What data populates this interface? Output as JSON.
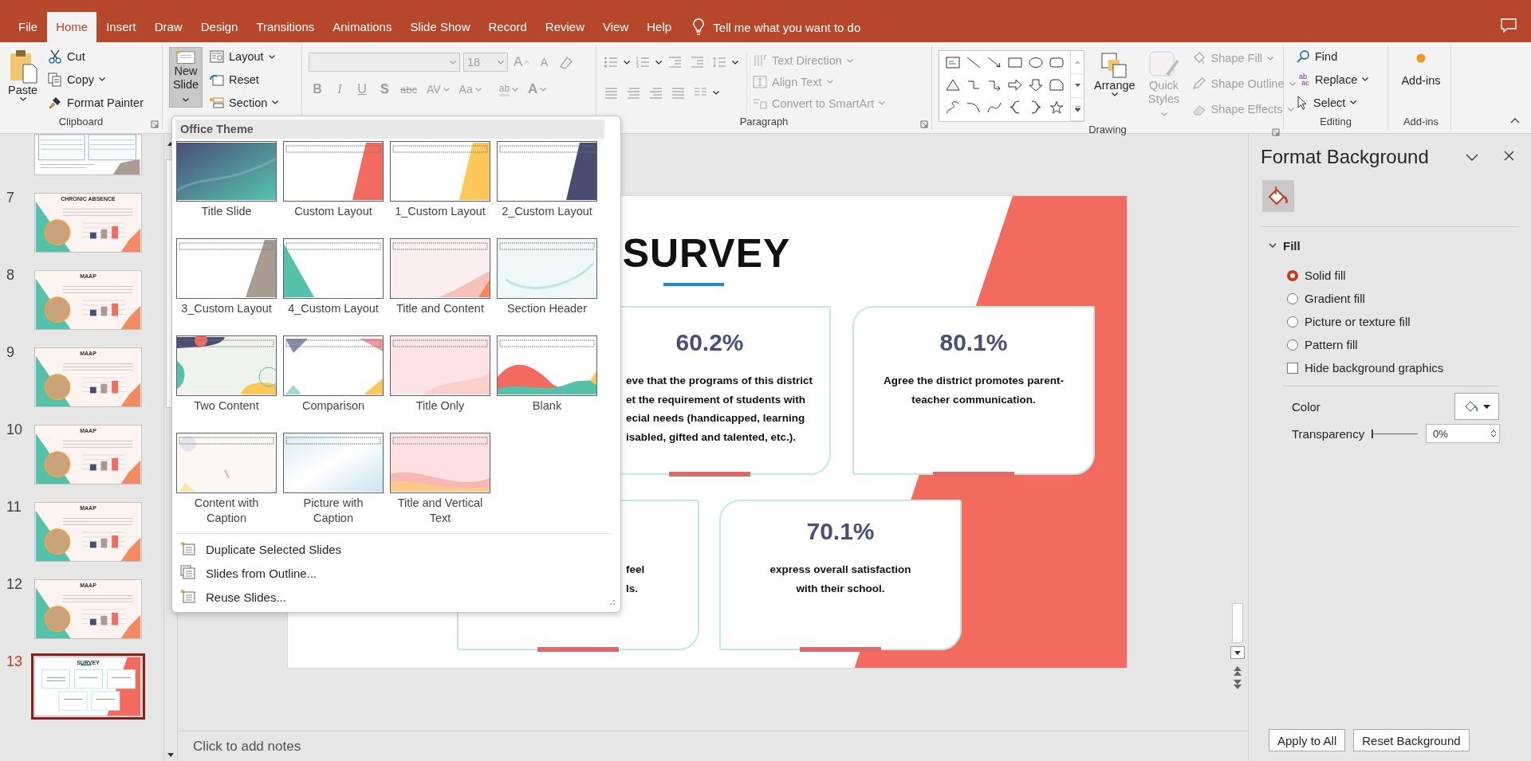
{
  "tabs": [
    {
      "label": "File",
      "selected": false
    },
    {
      "label": "Home",
      "selected": true
    },
    {
      "label": "Insert",
      "selected": false
    },
    {
      "label": "Draw",
      "selected": false
    },
    {
      "label": "Design",
      "selected": false
    },
    {
      "label": "Transitions",
      "selected": false
    },
    {
      "label": "Animations",
      "selected": false
    },
    {
      "label": "Slide Show",
      "selected": false
    },
    {
      "label": "Record",
      "selected": false
    },
    {
      "label": "Review",
      "selected": false
    },
    {
      "label": "View",
      "selected": false
    },
    {
      "label": "Help",
      "selected": false
    }
  ],
  "tell_me": "Tell me what you want to do",
  "ribbon": {
    "clipboard": {
      "label": "Clipboard",
      "paste": "Paste",
      "cut": "Cut",
      "copy": "Copy",
      "format_painter": "Format Painter"
    },
    "slides": {
      "new_slide": {
        "label": "New Slide",
        "expanded": true
      },
      "layout": "Layout",
      "reset": "Reset",
      "section": "Section"
    },
    "font": {
      "disabled": true,
      "size": "18",
      "grow": "A",
      "shrink": "A",
      "format_buttons": [
        {
          "label": "B",
          "kind": "bold"
        },
        {
          "label": "I",
          "kind": "italic"
        },
        {
          "label": "U",
          "kind": "underline"
        },
        {
          "label": "S",
          "kind": "shadow"
        },
        {
          "label": "abc",
          "kind": "strike"
        },
        {
          "label": "AV",
          "kind": "spacing"
        },
        {
          "label": "Aa",
          "kind": "case"
        }
      ],
      "highlight": "ab",
      "font_color": "A"
    },
    "paragraph": {
      "label": "Paragraph",
      "disabled": true,
      "text_direction": "Text Direction",
      "align_text": "Align Text",
      "smartart": "Convert to SmartArt"
    },
    "drawing": {
      "label": "Drawing",
      "arrange": "Arrange",
      "quick_styles": {
        "label": "Quick Styles",
        "disabled": true
      },
      "shape_commands": [
        {
          "label": "Shape Fill",
          "disabled": true
        },
        {
          "label": "Shape Outline",
          "disabled": true
        },
        {
          "label": "Shape Effects",
          "disabled": true
        }
      ]
    },
    "editing": {
      "label": "Editing",
      "find": "Find",
      "replace": "Replace",
      "replace_glyph": [
        "ab",
        "ac"
      ],
      "select": "Select"
    },
    "addins": {
      "button": "Add-ins",
      "label": "Add-ins"
    }
  },
  "new_slide_menu": {
    "header": "Office Theme",
    "layouts": [
      {
        "label": "Title Slide"
      },
      {
        "label": "Custom Layout"
      },
      {
        "label": "1_Custom Layout"
      },
      {
        "label": "2_Custom Layout"
      },
      {
        "label": "3_Custom Layout"
      },
      {
        "label": "4_Custom Layout"
      },
      {
        "label": "Title and Content"
      },
      {
        "label": "Section Header"
      },
      {
        "label": "Two Content"
      },
      {
        "label": "Comparison"
      },
      {
        "label": "Title Only"
      },
      {
        "label": "Blank"
      },
      {
        "label": "Content with Caption"
      },
      {
        "label": "Picture with Caption"
      },
      {
        "label": "Title and Vertical Text"
      }
    ],
    "commands": [
      {
        "label": "Duplicate Selected Slides",
        "kind": "duplicate"
      },
      {
        "label": "Slides from Outline...",
        "kind": "outline"
      },
      {
        "label": "Reuse Slides...",
        "kind": "reuse"
      }
    ]
  },
  "slides": [
    {
      "kind": "table",
      "selected": false
    },
    {
      "number": "7",
      "kind": "photo",
      "title": "CHRONIC ABSENCE",
      "selected": false
    },
    {
      "number": "8",
      "kind": "photo",
      "title": "MAAP",
      "selected": false
    },
    {
      "number": "9",
      "kind": "photo",
      "title": "MAAP",
      "selected": false
    },
    {
      "number": "10",
      "kind": "photo",
      "title": "MAAP",
      "selected": false
    },
    {
      "number": "11",
      "kind": "photo",
      "title": "MAAP",
      "selected": false
    },
    {
      "number": "12",
      "kind": "photo",
      "title": "MAAP",
      "selected": false
    },
    {
      "number": "13",
      "kind": "cards",
      "title": "SURVEY",
      "selected": true
    }
  ],
  "slide": {
    "title": "SURVEY",
    "cards": [
      {
        "value": "60.2%",
        "lines": [
          "eve that the programs of this district",
          "et the requirement of students with",
          "ecial needs (handicapped, learning",
          "isabled, gifted and talented, etc.)."
        ]
      },
      {
        "value": "80.1%",
        "lines": [
          "Agree the district promotes parent-",
          "teacher communication."
        ]
      },
      {
        "lines": [
          "feel",
          "ls."
        ]
      },
      {
        "value": "70.1%",
        "lines": [
          "express overall satisfaction",
          "with their school."
        ]
      }
    ]
  },
  "notes": {
    "placeholder": "Click to add notes"
  },
  "format_pane": {
    "title": "Format Background",
    "section": {
      "label": "Fill",
      "expanded": true
    },
    "fill_options": [
      {
        "label": "Solid fill",
        "selected": true
      },
      {
        "label": "Gradient fill",
        "selected": false
      },
      {
        "label": "Picture or texture fill",
        "selected": false
      },
      {
        "label": "Pattern fill",
        "selected": false
      }
    ],
    "hide_graphics": {
      "label": "Hide background graphics",
      "checked": false
    },
    "color_label": "Color",
    "transparency": {
      "label": "Transparency",
      "level": 0,
      "value": "0%"
    },
    "buttons": [
      "Apply to All",
      "Reset Background"
    ]
  }
}
